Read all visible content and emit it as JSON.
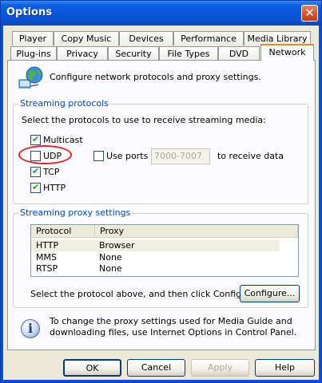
{
  "window": {
    "title": "Options"
  },
  "tabs": {
    "row1": [
      "Player",
      "Copy Music",
      "Devices",
      "Performance",
      "Media Library"
    ],
    "row2": [
      "Plug-ins",
      "Privacy",
      "Security",
      "File Types",
      "DVD",
      "Network"
    ],
    "active": "Network"
  },
  "intro": {
    "text": "Configure network protocols and proxy settings."
  },
  "streaming": {
    "title": "Streaming protocols",
    "instruction": "Select the protocols to use to receive streaming media:",
    "multicast": "Multicast",
    "udp": "UDP",
    "tcp": "TCP",
    "http": "HTTP",
    "use_ports": "Use ports",
    "ports_value": "7000-7007",
    "receive_text": "to receive data"
  },
  "proxy": {
    "title": "Streaming proxy settings",
    "columns": [
      "Protocol",
      "Proxy"
    ],
    "rows": [
      [
        "HTTP",
        "Browser"
      ],
      [
        "MMS",
        "None"
      ],
      [
        "RTSP",
        "None"
      ]
    ],
    "hint": "Select the protocol above, and then click Configure.",
    "configure": "Configure..."
  },
  "info": {
    "text": "To change the proxy settings used for Media Guide and downloading files, use Internet Options in Control Panel."
  },
  "buttons": {
    "ok": "OK",
    "cancel": "Cancel",
    "apply": "Apply",
    "help": "Help"
  },
  "colors": {
    "title_bar": "#0a55d8",
    "group_title": "#0046d5",
    "highlight": "#e2232a",
    "tab_accent": "#e68b2c"
  }
}
